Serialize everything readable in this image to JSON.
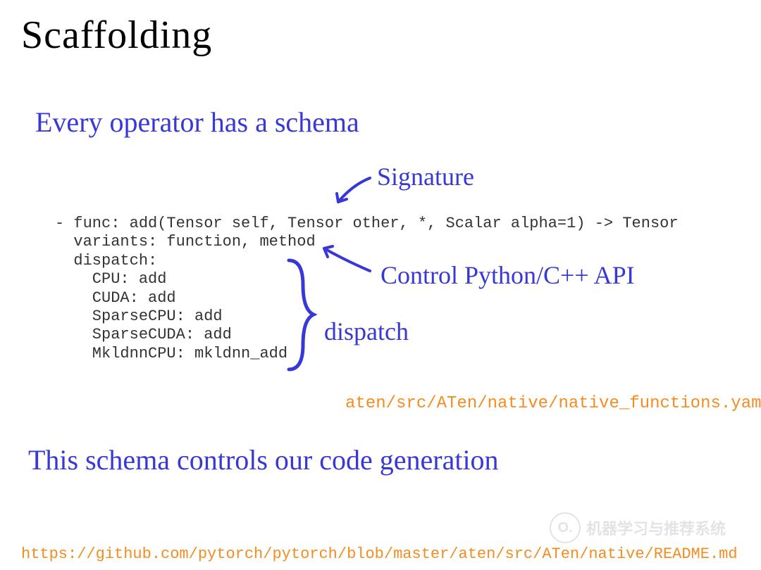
{
  "title": "Scaffolding",
  "line1": "Every operator has a schema",
  "annot_signature": "Signature",
  "annot_control": "Control Python/C++ API",
  "annot_dispatch": "dispatch",
  "code": "- func: add(Tensor self, Tensor other, *, Scalar alpha=1) -> Tensor\n  variants: function, method\n  dispatch:\n    CPU: add\n    CUDA: add\n    SparseCPU: add\n    SparseCUDA: add\n    MkldnnCPU: mkldnn_add",
  "file_path": "aten/src/ATen/native/native_functions.yaml",
  "line2": "This schema controls our code generation",
  "url": "https://github.com/pytorch/pytorch/blob/master/aten/src/ATen/native/README.md",
  "watermark_icon": "O.",
  "watermark_text": "机器学习与推荐系统"
}
